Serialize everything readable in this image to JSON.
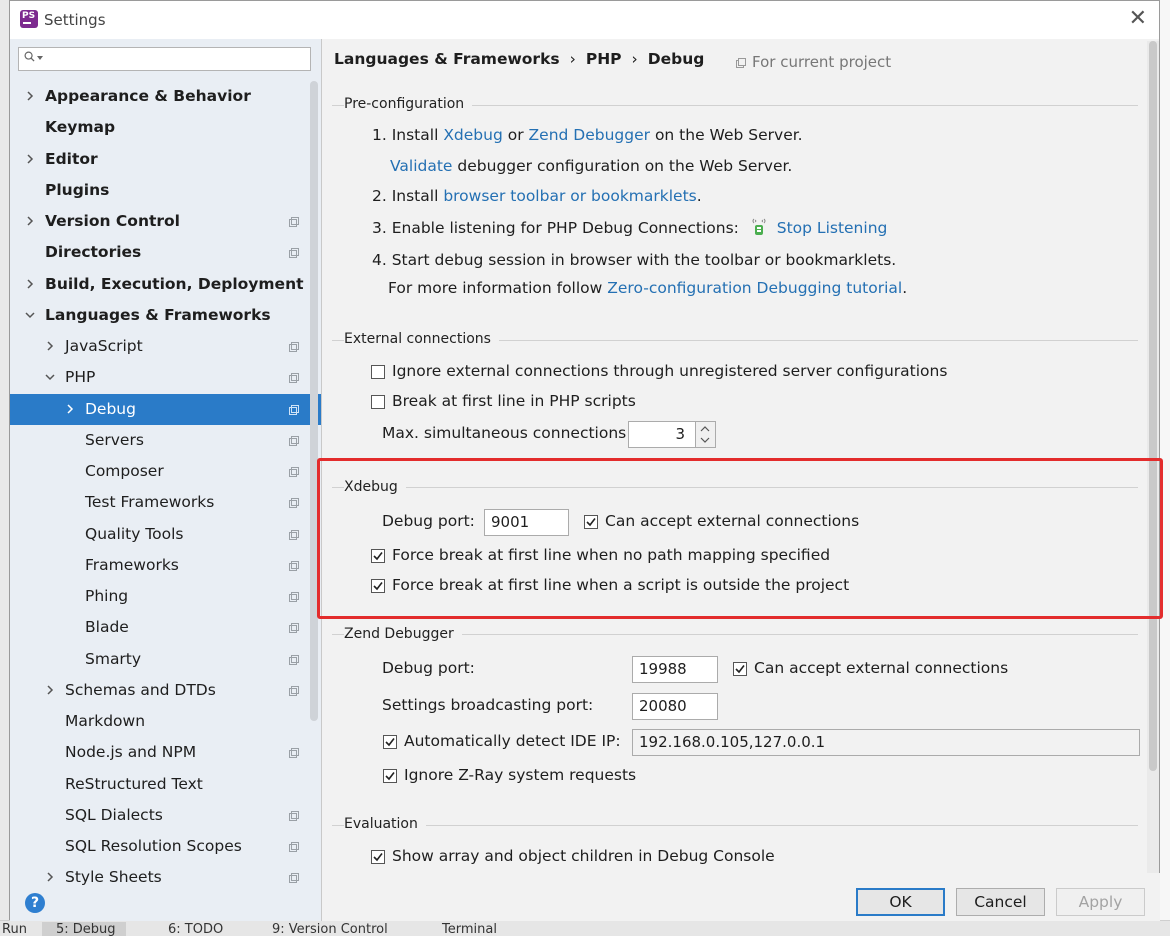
{
  "window": {
    "title": "Settings"
  },
  "search": {
    "placeholder": ""
  },
  "tree": [
    {
      "label": "Appearance & Behavior",
      "bold": true,
      "chevron": "right",
      "project": false
    },
    {
      "label": "Keymap",
      "bold": true,
      "chevron": "",
      "project": false
    },
    {
      "label": "Editor",
      "bold": true,
      "chevron": "right",
      "project": false
    },
    {
      "label": "Plugins",
      "bold": true,
      "chevron": "",
      "project": false
    },
    {
      "label": "Version Control",
      "bold": true,
      "chevron": "right",
      "project": true
    },
    {
      "label": "Directories",
      "bold": true,
      "chevron": "",
      "project": true
    },
    {
      "label": "Build, Execution, Deployment",
      "bold": true,
      "chevron": "right",
      "project": false
    },
    {
      "label": "Languages & Frameworks",
      "bold": true,
      "chevron": "down",
      "project": false
    },
    {
      "label": "JavaScript",
      "bold": false,
      "chevron": "right",
      "project": true
    },
    {
      "label": "PHP",
      "bold": false,
      "chevron": "down",
      "project": true
    },
    {
      "label": "Debug",
      "bold": false,
      "chevron": "right",
      "project": true,
      "selected": true
    },
    {
      "label": "Servers",
      "bold": false,
      "chevron": "",
      "project": true
    },
    {
      "label": "Composer",
      "bold": false,
      "chevron": "",
      "project": true
    },
    {
      "label": "Test Frameworks",
      "bold": false,
      "chevron": "",
      "project": true
    },
    {
      "label": "Quality Tools",
      "bold": false,
      "chevron": "",
      "project": true
    },
    {
      "label": "Frameworks",
      "bold": false,
      "chevron": "",
      "project": true
    },
    {
      "label": "Phing",
      "bold": false,
      "chevron": "",
      "project": true
    },
    {
      "label": "Blade",
      "bold": false,
      "chevron": "",
      "project": true
    },
    {
      "label": "Smarty",
      "bold": false,
      "chevron": "",
      "project": true
    },
    {
      "label": "Schemas and DTDs",
      "bold": false,
      "chevron": "right",
      "project": true
    },
    {
      "label": "Markdown",
      "bold": false,
      "chevron": "",
      "project": false
    },
    {
      "label": "Node.js and NPM",
      "bold": false,
      "chevron": "",
      "project": true
    },
    {
      "label": "ReStructured Text",
      "bold": false,
      "chevron": "",
      "project": false
    },
    {
      "label": "SQL Dialects",
      "bold": false,
      "chevron": "",
      "project": true
    },
    {
      "label": "SQL Resolution Scopes",
      "bold": false,
      "chevron": "",
      "project": true
    },
    {
      "label": "Style Sheets",
      "bold": false,
      "chevron": "right",
      "project": true
    }
  ],
  "breadcrumb": [
    "Languages & Frameworks",
    "PHP",
    "Debug"
  ],
  "for_project": "For current project",
  "preconfig": {
    "title": "Pre-configuration",
    "step1_prefix": "1. Install",
    "xdebug_link": "Xdebug",
    "or": "or",
    "zend_link": "Zend Debugger",
    "step1_suffix": "on the Web Server.",
    "validate_link": "Validate",
    "validate_suffix": "debugger configuration on the Web Server.",
    "step2_prefix": "2. Install",
    "toolbar_link": "browser toolbar or bookmarklets",
    "step2_suffix": ".",
    "step3": "3. Enable listening for PHP Debug Connections:",
    "stop_link": "Stop Listening",
    "step4": "4. Start debug session in browser with the toolbar or bookmarklets.",
    "more_prefix": "For more information follow",
    "tutorial_link": "Zero-configuration Debugging tutorial",
    "more_suffix": "."
  },
  "external": {
    "title": "External connections",
    "ignore_label": "Ignore external connections through unregistered server configurations",
    "ignore_checked": false,
    "break_label": "Break at first line in PHP scripts",
    "break_checked": false,
    "max_label": "Max. simultaneous connections:",
    "max_value": "3"
  },
  "xdebug": {
    "title": "Xdebug",
    "port_label": "Debug port:",
    "port_value": "9001",
    "accept_label": "Can accept external connections",
    "accept_checked": true,
    "force_mapping_label": "Force break at first line when no path mapping specified",
    "force_mapping_checked": true,
    "force_outside_label": "Force break at first line when a script is outside the project",
    "force_outside_checked": true
  },
  "zend": {
    "title": "Zend Debugger",
    "port_label": "Debug port:",
    "port_value": "19988",
    "accept_label": "Can accept external connections",
    "accept_checked": true,
    "broadcast_label": "Settings broadcasting port:",
    "broadcast_value": "20080",
    "detect_label": "Automatically detect IDE IP:",
    "detect_checked": true,
    "detect_value": "192.168.0.105,127.0.0.1",
    "zray_label": "Ignore Z-Ray system requests",
    "zray_checked": true
  },
  "evaluation": {
    "title": "Evaluation",
    "show_label": "Show array and object children in Debug Console",
    "show_checked": true
  },
  "buttons": {
    "ok": "OK",
    "cancel": "Cancel",
    "apply": "Apply",
    "help": "?"
  },
  "statusbar": [
    "Run",
    "5: Debug",
    "6: TODO",
    "9: Version Control",
    "Terminal"
  ],
  "colors": {
    "accent": "#2a7bc8",
    "link": "#2470b3",
    "highlight": "#e32c2c"
  }
}
